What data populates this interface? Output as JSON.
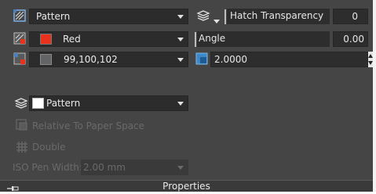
{
  "hatch": {
    "type": "Pattern",
    "color": "Red",
    "background_color": "99,100,102",
    "pattern": "Pattern"
  },
  "props": {
    "transparency_label": "Hatch Transparency",
    "transparency_value": "0",
    "angle_label": "Angle",
    "angle_value": "0.00",
    "scale_value": "2.0000"
  },
  "options": {
    "relative_label": "Relative To Paper Space",
    "double_label": "Double",
    "iso_pen_label": "ISO Pen Width:",
    "iso_pen_value": "2.00 mm"
  },
  "footer": {
    "title": "Properties"
  },
  "colors": {
    "red_swatch": "#e8321e",
    "background_swatch": "#636466",
    "pattern_swatch": "#ffffff"
  }
}
